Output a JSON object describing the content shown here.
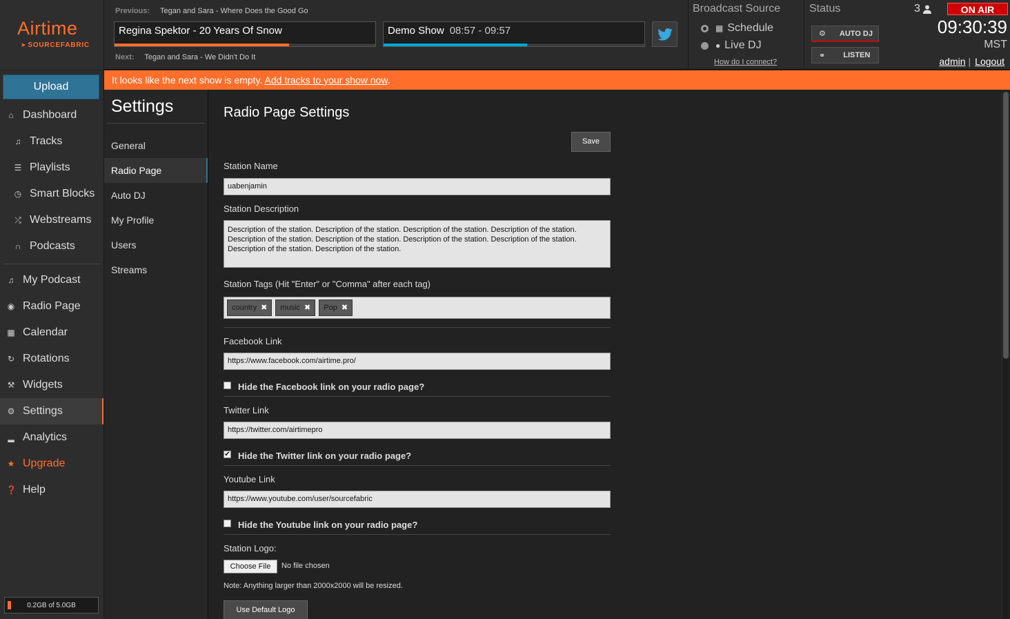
{
  "logo": {
    "word": "Airtime",
    "sub": "SOURCEFABRIC",
    "color": "#ff6f2b"
  },
  "now_playing": {
    "previous_label": "Previous:",
    "previous_track": "Tegan and Sara - Where Does the Good Go",
    "current_track": "Regina Spektor - 20 Years Of Snow",
    "current_progress": 0.67,
    "show_name": "Demo Show",
    "show_time": "08:57 - 09:57",
    "show_progress": 0.55,
    "next_label": "Next:",
    "next_track": "Tegan and Sara - We Didn't Do It",
    "twitter_icon": "twitter-bird-icon"
  },
  "broadcast_source": {
    "heading": "Broadcast Source",
    "schedule_label": "Schedule",
    "live_dj_label": "Live DJ",
    "selected": "schedule",
    "help_link": "How do I connect?"
  },
  "status": {
    "heading": "Status",
    "listener_count": "3",
    "on_air_label": "ON AIR",
    "auto_dj_label": "AUTO DJ",
    "listen_label": "LISTEN",
    "clock": "09:30:39",
    "timezone": "MST",
    "user_link": "admin",
    "logout_link": "Logout"
  },
  "nav": {
    "upload_label": "Upload",
    "items": [
      {
        "label": "Dashboard",
        "icon": "home-icon"
      },
      {
        "label": "Tracks",
        "icon": "music-note-icon"
      },
      {
        "label": "Playlists",
        "icon": "list-icon"
      },
      {
        "label": "Smart Blocks",
        "icon": "clock-icon"
      },
      {
        "label": "Webstreams",
        "icon": "shuffle-icon"
      },
      {
        "label": "Podcasts",
        "icon": "headphones-icon"
      },
      {
        "label": "My Podcast",
        "icon": "music-note-icon"
      },
      {
        "label": "Radio Page",
        "icon": "globe-icon"
      },
      {
        "label": "Calendar",
        "icon": "calendar-icon"
      },
      {
        "label": "Rotations",
        "icon": "refresh-icon"
      },
      {
        "label": "Widgets",
        "icon": "wrench-icon"
      },
      {
        "label": "Settings",
        "icon": "gear-icon"
      },
      {
        "label": "Analytics",
        "icon": "signal-icon"
      },
      {
        "label": "Upgrade",
        "icon": "star-icon"
      },
      {
        "label": "Help",
        "icon": "question-icon"
      }
    ],
    "active": "Settings",
    "storage_label": "0.2GB of 5.0GB",
    "storage_used_fraction": 0.04
  },
  "banner": {
    "text": "It looks like the next show is empty. ",
    "link": "Add tracks to your show now",
    "end": "."
  },
  "settings_nav": {
    "title": "Settings",
    "items": [
      "General",
      "Radio Page",
      "Auto DJ",
      "My Profile",
      "Users",
      "Streams"
    ],
    "active": "Radio Page"
  },
  "form": {
    "title": "Radio Page Settings",
    "save_label": "Save",
    "station_name_label": "Station Name",
    "station_name_value": "uabenjamin",
    "station_description_label": "Station Description",
    "station_description_value": "Description of the station. Description of the station. Description of the station. Description of the station. Description of the station. Description of the station. Description of the station. Description of the station. Description of the station. Description of the station.",
    "station_tags_label": "Station Tags (Hit \"Enter\" or \"Comma\" after each tag)",
    "tags": [
      "country",
      "music",
      "Pop"
    ],
    "facebook_label": "Facebook Link",
    "facebook_value": "https://www.facebook.com/airtime.pro/",
    "hide_facebook_label": "Hide the Facebook link on your radio page?",
    "hide_facebook_checked": false,
    "twitter_label": "Twitter Link",
    "twitter_value": "https://twitter.com/airtimepro",
    "hide_twitter_label": "Hide the Twitter link on your radio page?",
    "hide_twitter_checked": true,
    "youtube_label": "Youtube Link",
    "youtube_value": "https://www.youtube.com/user/sourcefabric",
    "hide_youtube_label": "Hide the Youtube link on your radio page?",
    "hide_youtube_checked": false,
    "logo_label": "Station Logo:",
    "choose_file_label": "Choose File",
    "no_file_label": "No file chosen",
    "logo_note": "Note: Anything larger than 2000x2000 will be resized.",
    "default_logo_label": "Use Default Logo"
  },
  "colors": {
    "accent_orange": "#ff6f2b",
    "on_air_red": "#d10000",
    "upload_blue": "#2f7396",
    "show_progress_blue": "#00a6d8"
  }
}
